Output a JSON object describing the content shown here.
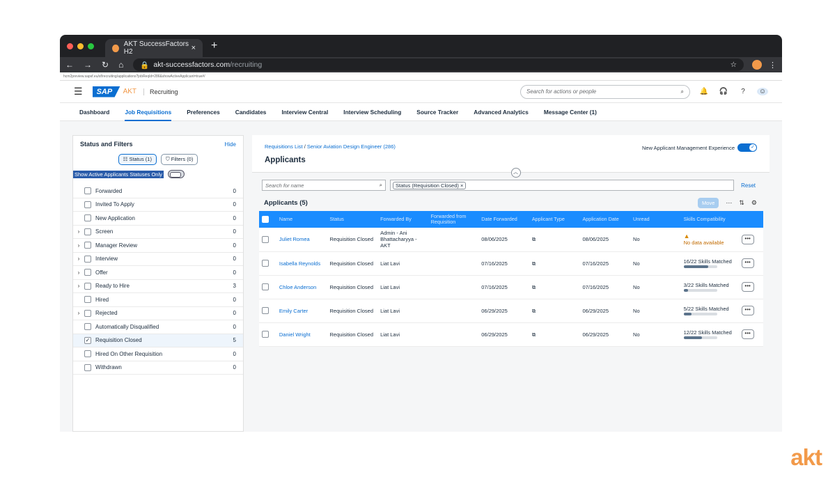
{
  "browser": {
    "tab_title": "AKT SuccessFactors H2",
    "url_host": "akt-successfactors.com",
    "url_path": "/recruiting",
    "inner_url": "hcm2preview.sapsf.eu/sf/recruiting/applications?jobReqId=286&showActiveApplicant=true#/"
  },
  "shell": {
    "brand": "AKT",
    "module": "Recruiting",
    "search_placeholder": "Search for actions or people"
  },
  "nav": {
    "tabs": [
      "Dashboard",
      "Job Requisitions",
      "Preferences",
      "Candidates",
      "Interview Central",
      "Interview Scheduling",
      "Source Tracker",
      "Advanced Analytics",
      "Message Center (1)"
    ]
  },
  "filters": {
    "title": "Status and Filters",
    "hide": "Hide",
    "status_pill": "Status (1)",
    "filters_pill": "Filters (0)",
    "toggle_label": "Show Active Applicants Statuses Only",
    "items": [
      {
        "label": "Forwarded",
        "count": "0",
        "expand": false,
        "checked": false
      },
      {
        "label": "Invited To Apply",
        "count": "0",
        "expand": false,
        "checked": false
      },
      {
        "label": "New Application",
        "count": "0",
        "expand": false,
        "checked": false
      },
      {
        "label": "Screen",
        "count": "0",
        "expand": true,
        "checked": false
      },
      {
        "label": "Manager Review",
        "count": "0",
        "expand": true,
        "checked": false
      },
      {
        "label": "Interview",
        "count": "0",
        "expand": true,
        "checked": false
      },
      {
        "label": "Offer",
        "count": "0",
        "expand": true,
        "checked": false
      },
      {
        "label": "Ready to Hire",
        "count": "3",
        "expand": true,
        "checked": false
      },
      {
        "label": "Hired",
        "count": "0",
        "expand": false,
        "checked": false
      },
      {
        "label": "Rejected",
        "count": "0",
        "expand": true,
        "checked": false
      },
      {
        "label": "Automatically Disqualified",
        "count": "0",
        "expand": false,
        "checked": false
      },
      {
        "label": "Requisition Closed",
        "count": "5",
        "expand": false,
        "checked": true
      },
      {
        "label": "Hired On Other Requisition",
        "count": "0",
        "expand": false,
        "checked": false
      },
      {
        "label": "Withdrawn",
        "count": "0",
        "expand": false,
        "checked": false
      }
    ]
  },
  "main": {
    "breadcrumb_link": "Requisitions List",
    "breadcrumb_sep": " / ",
    "breadcrumb_current": "Senior Aviation Design Engineer (286)",
    "title": "Applicants",
    "nam_label": "New Applicant Management Experience",
    "search_placeholder": "Search for name",
    "token": "Status (Requisition Closed)",
    "reset": "Reset",
    "applicants_title": "Applicants (5)",
    "move": "Move",
    "columns": [
      "Name",
      "Status",
      "Forwarded By",
      "Forwarded from Requisition",
      "Date Forwarded",
      "Applicant Type",
      "Application Date",
      "Unread",
      "Skills Compatibility"
    ],
    "rows": [
      {
        "name": "Juliet Romea",
        "status": "Requisition Closed",
        "forwarded_by": "Admin - Ani Bhattacharyya - AKT",
        "fwd_req": "",
        "date_fwd": "08/06/2025",
        "app_date": "08/06/2025",
        "unread": "No",
        "skills": "No data available",
        "skills_frac": null
      },
      {
        "name": "Isabella Reynolds",
        "status": "Requisition Closed",
        "forwarded_by": "Liat Lavi",
        "fwd_req": "",
        "date_fwd": "07/16/2025",
        "app_date": "07/16/2025",
        "unread": "No",
        "skills": "16/22 Skills Matched",
        "skills_frac": 0.73
      },
      {
        "name": "Chloe Anderson",
        "status": "Requisition Closed",
        "forwarded_by": "Liat Lavi",
        "fwd_req": "",
        "date_fwd": "07/16/2025",
        "app_date": "07/16/2025",
        "unread": "No",
        "skills": "3/22 Skills Matched",
        "skills_frac": 0.14
      },
      {
        "name": "Emily Carter",
        "status": "Requisition Closed",
        "forwarded_by": "Liat Lavi",
        "fwd_req": "",
        "date_fwd": "06/29/2025",
        "app_date": "06/29/2025",
        "unread": "No",
        "skills": "5/22 Skills Matched",
        "skills_frac": 0.23
      },
      {
        "name": "Daniel Wright",
        "status": "Requisition Closed",
        "forwarded_by": "Liat Lavi",
        "fwd_req": "",
        "date_fwd": "06/29/2025",
        "app_date": "06/29/2025",
        "unread": "No",
        "skills": "12/22 Skills Matched",
        "skills_frac": 0.55
      }
    ]
  },
  "watermark": "akt",
  "colors": {
    "accent": "#0a6ed1",
    "header": "#1a8cff",
    "brand": "#f29a4a"
  }
}
